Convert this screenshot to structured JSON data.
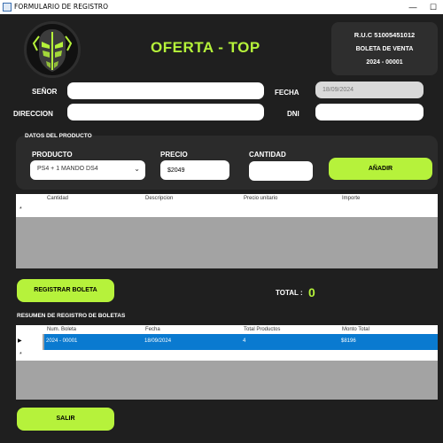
{
  "window": {
    "title": "FORMULARIO DE REGISTRO",
    "minimize_glyph": "—",
    "maximize_glyph": "☐"
  },
  "header": {
    "heading": "OFERTA - TOP",
    "logo_icon": "predator-mask-icon",
    "ruc": "R.U.C 51005451012",
    "doc_type": "BOLETA DE VENTA",
    "doc_number": "2024 - 00001"
  },
  "customer": {
    "senor_label": "SEÑOR",
    "senor_value": "",
    "fecha_label": "FECHA",
    "fecha_value": "18/09/2024",
    "direccion_label": "DIRECCION",
    "direccion_value": "",
    "dni_label": "DNI",
    "dni_value": ""
  },
  "product": {
    "group_title": "DATOS DEL PRODUCTO",
    "producto_label": "PRODUCTO",
    "producto_selected": "PS4 + 1 MANDO DS4",
    "precio_label": "PRECIO",
    "precio_value": "$2049",
    "cantidad_label": "CANTIDAD",
    "cantidad_value": "",
    "add_button": "AÑADIR"
  },
  "items_table": {
    "columns": [
      "Cantidad",
      "Descripcion",
      "Precio unitario",
      "Importe"
    ],
    "new_row_marker": "*"
  },
  "actions": {
    "register_button": "REGISTRAR BOLETA",
    "total_label": "TOTAL :",
    "total_value": "0",
    "exit_button": "SALIR"
  },
  "summary": {
    "title": "RESUMEN DE REGISTRO DE BOLETAS",
    "columns": [
      "Num. Boleta",
      "Fecha",
      "Total Productos",
      "Monto Total"
    ],
    "rows": [
      {
        "num": "2024 - 00001",
        "fecha": "18/09/2024",
        "total_productos": "4",
        "monto": "$8196"
      }
    ],
    "current_row_marker": "▶",
    "new_row_marker": "*"
  },
  "colors": {
    "accent": "#b5f23a",
    "background": "#1f1f1f",
    "panel": "#2b2b2b",
    "selection": "#0a7ad0"
  }
}
